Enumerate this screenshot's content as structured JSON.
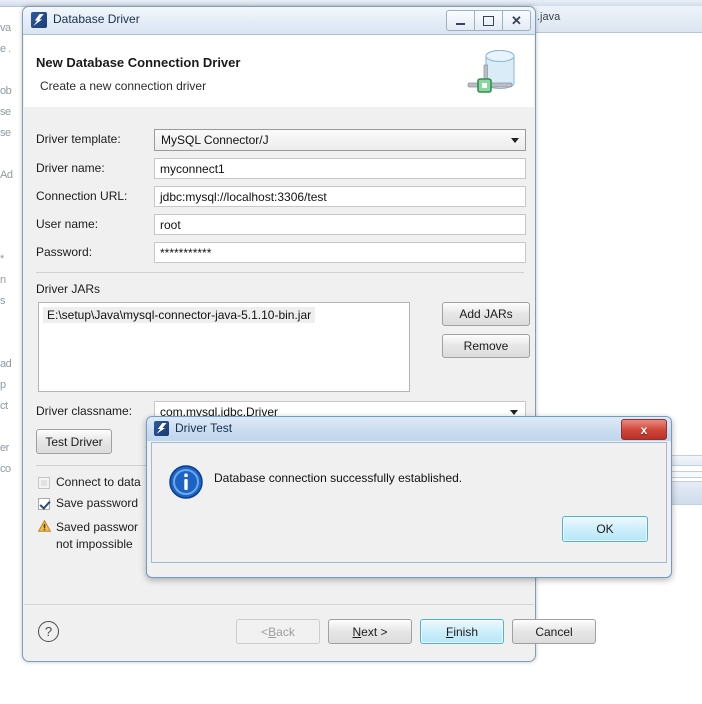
{
  "background": {
    "editor_fragments": "va\ne .\n\nob\nse\nse\n\nAd\n\n\n\n*\nn\ns\n\n\nad\np\nct\n\ner\nco",
    "tab_label": ".java"
  },
  "window": {
    "title": "Database Driver",
    "icon": "eclipse-icon",
    "controls": {
      "minimize": "minimize-icon",
      "maximize": "maximize-icon",
      "close": "close-icon"
    }
  },
  "banner": {
    "title": "New Database Connection Driver",
    "subtitle": "Create a new connection driver",
    "icon": "database-connection-icon"
  },
  "form": {
    "fields": [
      {
        "label": "Driver template:",
        "value": "MySQL Connector/J",
        "type": "combo"
      },
      {
        "label": "Driver name:",
        "value": "myconnect1",
        "type": "text"
      },
      {
        "label": "Connection URL:",
        "value": "jdbc:mysql://localhost:3306/test",
        "type": "text"
      },
      {
        "label": "User name:",
        "value": "root",
        "type": "text"
      },
      {
        "label": "Password:",
        "value": "***********",
        "type": "password"
      }
    ],
    "jars_section_label": "Driver JARs",
    "jars": [
      "E:\\setup\\Java\\mysql-connector-java-5.1.10-bin.jar"
    ],
    "add_jars_label": "Add JARs",
    "remove_label": "Remove",
    "classname_label": "Driver classname:",
    "classname_value": "com.mysql.jdbc.Driver",
    "test_driver_label": "Test Driver",
    "checkboxes": [
      {
        "label": "Connect to data",
        "checked": false,
        "enabled": false
      },
      {
        "label": "Save password",
        "checked": true,
        "enabled": true
      }
    ],
    "warning": {
      "icon": "warning-icon",
      "line1": "Saved passwor",
      "line2": "not impossible"
    }
  },
  "footer": {
    "help_icon": "help-icon",
    "buttons": [
      {
        "label": "< Back",
        "mnemonic_before": "< ",
        "mnemonic": "B",
        "mnemonic_after": "ack",
        "state": "disabled"
      },
      {
        "label": "Next >",
        "mnemonic_before": "",
        "mnemonic": "N",
        "mnemonic_after": "ext >",
        "state": "normal"
      },
      {
        "label": "Finish",
        "mnemonic_before": "",
        "mnemonic": "F",
        "mnemonic_after": "inish",
        "state": "default"
      },
      {
        "label": "Cancel",
        "mnemonic_before": "",
        "mnemonic": "",
        "mnemonic_after": "Cancel",
        "state": "normal"
      }
    ]
  },
  "dialog": {
    "title": "Driver Test",
    "icon": "eclipse-icon",
    "close_label": "x",
    "message": "Database connection successfully established.",
    "message_icon": "info-icon",
    "ok_label": "OK"
  },
  "colors": {
    "window_bg": "#f0f0f0",
    "titlebar": "#dae5f2",
    "focus_ring": "#3fb7e0",
    "close_red": "#cf4436",
    "info_blue": "#1b63c4",
    "warning_amber": "#e8a93a"
  }
}
